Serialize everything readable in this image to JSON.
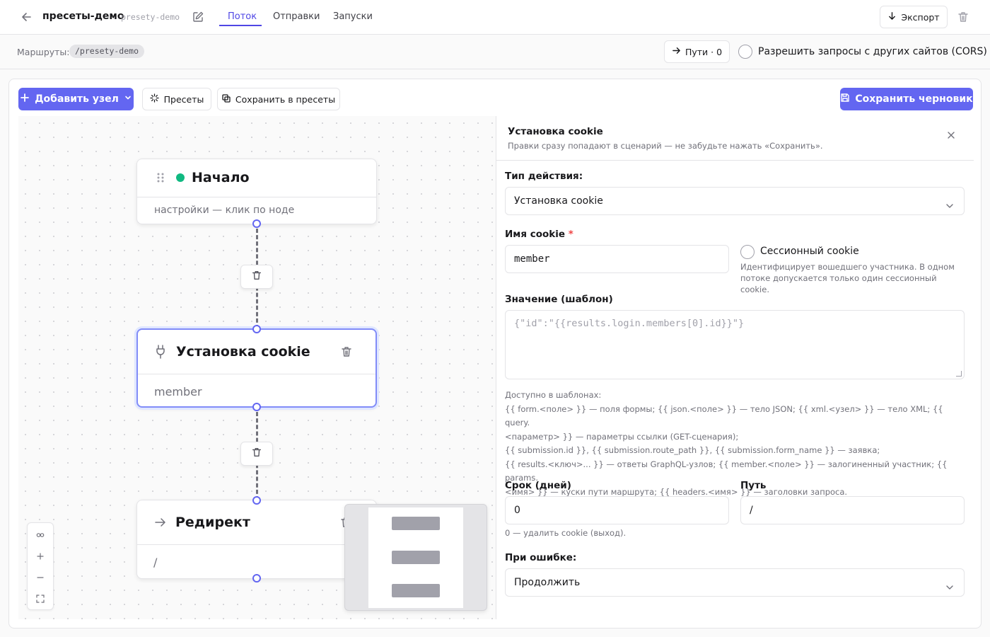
{
  "header": {
    "title": "пресеты-демо",
    "slug": "presety-demo",
    "tabs": [
      {
        "label": "Поток",
        "active": true
      },
      {
        "label": "Отправки",
        "active": false
      },
      {
        "label": "Запуски",
        "active": false
      }
    ],
    "export_label": "Экспорт"
  },
  "routes": {
    "label": "Маршруты:",
    "route": "/presety-demo",
    "paths_label": "Пути · 0",
    "cors_label": "Разрешить запросы с других сайтов (CORS)",
    "cors_checked": false
  },
  "toolbar": {
    "add_node_label": "Добавить узел",
    "presets_label": "Пресеты",
    "save_presets_label": "Сохранить в пресеты",
    "save_draft_label": "Сохранить черновик"
  },
  "colors": {
    "accent": "#6366f1",
    "start_dot": "#10b981",
    "selected_border": "#818cf8"
  },
  "canvas": {
    "nodes": [
      {
        "title": "Начало",
        "subtitle": "настройки — клик по ноде",
        "icon": "drag-grip-icon",
        "status": "active"
      },
      {
        "title": "Установка cookie",
        "subtitle": "member",
        "icon": "plug-icon",
        "selected": true
      },
      {
        "title": "Редирект",
        "subtitle": "/",
        "icon": "arrow-right-icon"
      }
    ]
  },
  "panel": {
    "title": "Установка cookie",
    "hint": "Правки сразу попадают в сценарий — не забудьте нажать «Сохранить».",
    "action_type_label": "Тип действия:",
    "action_type_value": "Установка cookie",
    "cookie_name_label": "Имя cookie",
    "cookie_name_required": "*",
    "cookie_name_value": "member",
    "session_label": "Сессионный cookie",
    "session_checked": false,
    "session_help": "Идентифицирует вошедшего участника. В одном потоке допускается только один сессионный cookie.",
    "value_label": "Значение (шаблон)",
    "value_placeholder": "{\"id\":\"{{results.login.members[0].id}}\"}",
    "template_help": [
      "Доступно в шаблонах:",
      "{{ form.<поле> }} — поля формы; {{ json.<поле> }} — тело JSON; {{ xml.<узел> }} — тело XML; {{ query.",
      "<параметр> }} — параметры ссылки (GET-сценария);",
      "{{ submission.id }}, {{ submission.route_path }}, {{ submission.form_name }} — заявка;",
      "{{ results.<ключ>... }} — ответы GraphQL-узлов; {{ member.<поле> }} — залогиненный участник; {{ params.",
      "<имя> }} — куски пути маршрута; {{ headers.<имя> }} — заголовки запроса."
    ],
    "days_label": "Срок (дней)",
    "days_value": "0",
    "days_hint": "0 — удалить cookie (выход).",
    "path_label": "Путь",
    "path_value": "/",
    "on_error_label": "При ошибке:",
    "on_error_value": "Продолжить"
  }
}
